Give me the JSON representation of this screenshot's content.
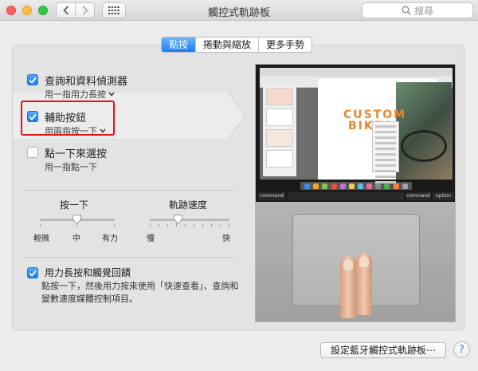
{
  "window": {
    "title": "觸控式軌跡板"
  },
  "search": {
    "placeholder": "搜尋"
  },
  "tabs": [
    {
      "label": "點按",
      "active": true
    },
    {
      "label": "捲動與縮放",
      "active": false
    },
    {
      "label": "更多手勢",
      "active": false
    }
  ],
  "options": [
    {
      "title": "查詢和資料偵測器",
      "subtitle": "用一指用力長按",
      "checked": true,
      "has_menu": true
    },
    {
      "title": "輔助按鈕",
      "subtitle": "用兩指按一下",
      "checked": true,
      "has_menu": true
    },
    {
      "title": "點一下來選按",
      "subtitle": "用一指點一下",
      "checked": false,
      "has_menu": false
    }
  ],
  "click_slider": {
    "label": "按一下",
    "ticks": [
      "輕微",
      "中",
      "有力"
    ],
    "value_fraction": 0.5
  },
  "tracking_slider": {
    "label": "軌跡速度",
    "min_label": "慢",
    "max_label": "快",
    "value_fraction": 0.35
  },
  "force_click": {
    "title": "用力長按和觸覺回饋",
    "checked": true,
    "description": "點按一下，然後用力按來使用「快速查看」、查詢和變數速度媒體控制項目。"
  },
  "preview": {
    "poster_text_line1": "CUSTOM",
    "poster_text_line2": "BIKES",
    "key_left": "command",
    "key_right_1": "command",
    "key_right_2": "option"
  },
  "bottom": {
    "bluetooth_button": "設定藍牙觸控式軌跡板⋯",
    "help_label": "?"
  },
  "colors": {
    "accent": "#1b7ef5",
    "highlight": "#e0141a"
  }
}
